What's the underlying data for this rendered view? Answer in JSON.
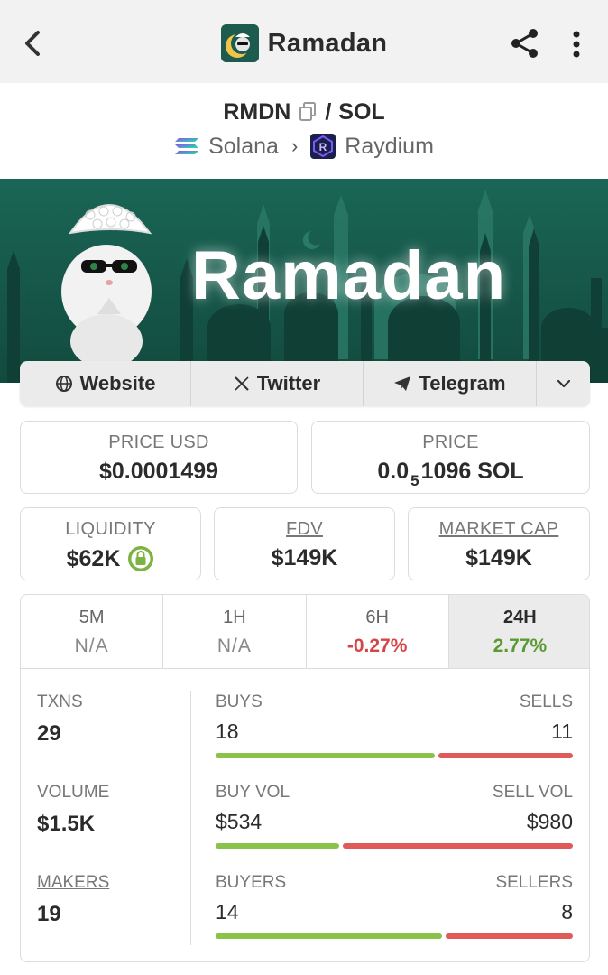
{
  "header": {
    "title": "Ramadan",
    "back_icon": "back-arrow-icon",
    "share_icon": "share-icon",
    "more_icon": "more-vertical-icon"
  },
  "pair": {
    "base": "RMDN",
    "separator": "/",
    "quote": "SOL",
    "chain": "Solana",
    "dex": "Raydium"
  },
  "banner": {
    "text": "Ramadan"
  },
  "links": [
    {
      "label": "Website",
      "icon": "globe-icon"
    },
    {
      "label": "Twitter",
      "icon": "x-logo-icon"
    },
    {
      "label": "Telegram",
      "icon": "telegram-icon"
    }
  ],
  "price": {
    "usd_label": "PRICE USD",
    "usd_value": "$0.0001499",
    "native_label": "PRICE",
    "native_prefix": "0.0",
    "native_zeros": "5",
    "native_rest": "1096 SOL"
  },
  "metrics": {
    "liquidity_label": "LIQUIDITY",
    "liquidity_value": "$62K",
    "fdv_label": "FDV",
    "fdv_value": "$149K",
    "mcap_label": "MARKET CAP",
    "mcap_value": "$149K"
  },
  "timeframes": [
    {
      "label": "5M",
      "value": "N/A",
      "kind": "na"
    },
    {
      "label": "1H",
      "value": "N/A",
      "kind": "na"
    },
    {
      "label": "6H",
      "value": "-0.27%",
      "kind": "neg"
    },
    {
      "label": "24H",
      "value": "2.77%",
      "kind": "pos",
      "active": true
    }
  ],
  "stats": {
    "txns_label": "TXNS",
    "txns_value": "29",
    "volume_label": "VOLUME",
    "volume_value": "$1.5K",
    "makers_label": "MAKERS",
    "makers_value": "19",
    "buys_label": "BUYS",
    "buys_value": "18",
    "sells_label": "SELLS",
    "sells_value": "11",
    "buyvol_label": "BUY VOL",
    "buyvol_value": "$534",
    "sellvol_label": "SELL VOL",
    "sellvol_value": "$980",
    "buyers_label": "BUYERS",
    "buyers_value": "14",
    "sellers_label": "SELLERS",
    "sellers_value": "8"
  },
  "ratios": {
    "buys_sells": 0.62,
    "buyvol_sellvol": 0.35,
    "buyers_sellers": 0.64
  },
  "colors": {
    "topbar": "#f2f2f2",
    "banner": "#175a4c",
    "positive": "#5a9a32",
    "negative": "#d64545",
    "buy_bar": "#8bc34a",
    "sell_bar": "#e05a5a",
    "lock_badge": "#7cb342"
  }
}
